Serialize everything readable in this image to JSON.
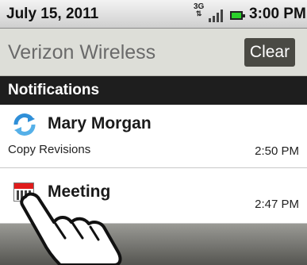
{
  "status_bar": {
    "date": "July 15, 2011",
    "network": "3G",
    "network_arrows": "⇅",
    "time": "3:00 PM",
    "battery_color": "#2bd12b"
  },
  "carrier": {
    "name": "Verizon Wireless",
    "clear_label": "Clear"
  },
  "notifications": {
    "header": "Notifications",
    "items": [
      {
        "icon": "sync-icon",
        "title": "Mary Morgan",
        "subtitle": "Copy Revisions",
        "time": "2:50 PM"
      },
      {
        "icon": "calendar-icon",
        "title": "Meeting",
        "subtitle": "",
        "time": "2:47 PM"
      }
    ]
  }
}
